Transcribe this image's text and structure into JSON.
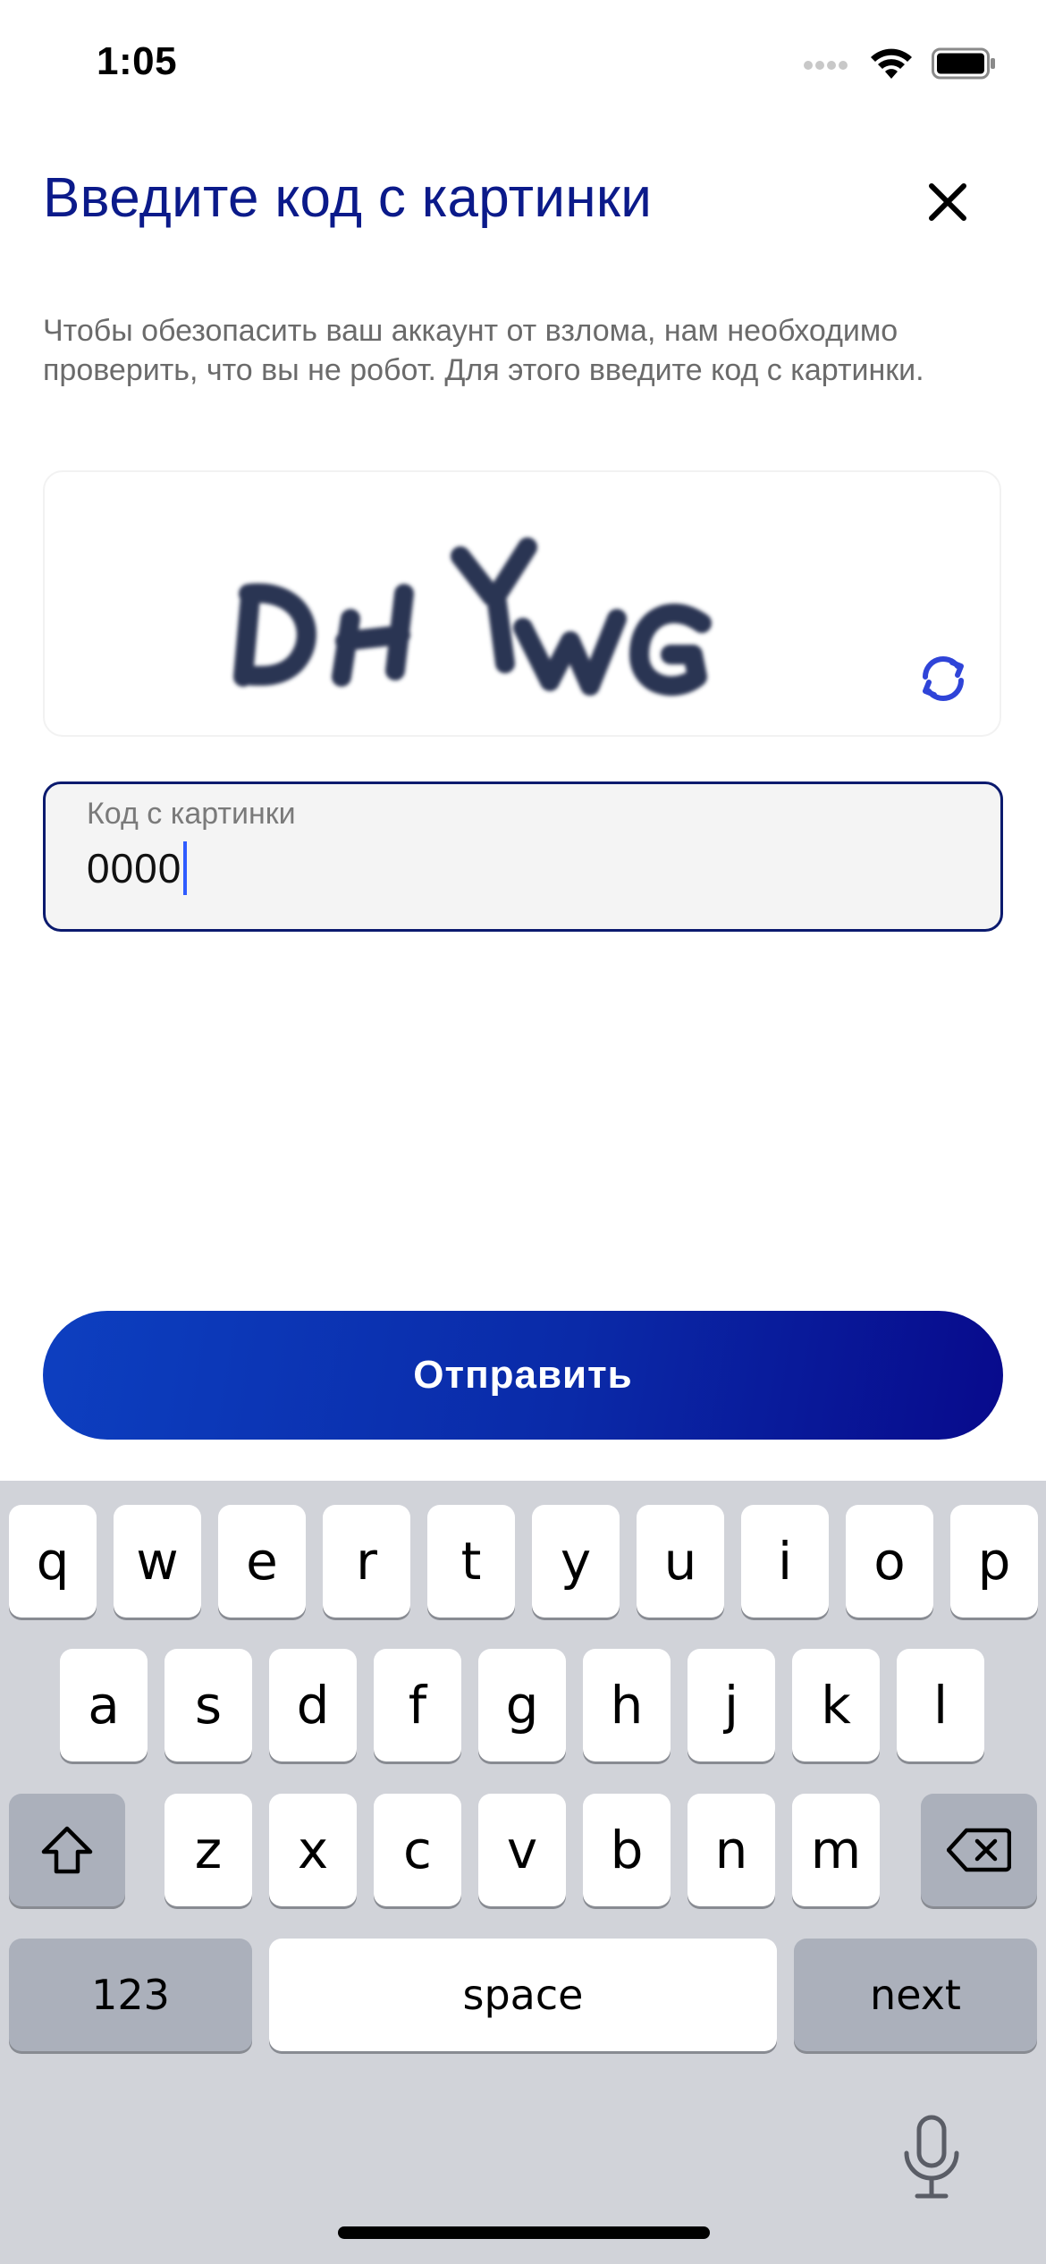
{
  "status_bar": {
    "time": "1:05"
  },
  "dialog": {
    "title": "Введите код с картинки",
    "description": "Чтобы обезопасить ваш аккаунт от взлома, нам необходимо проверить, что вы не робот. Для этого введите код с картинки.",
    "captcha_text": "DHYWG",
    "code_field": {
      "label": "Код с картинки",
      "value": "0000"
    },
    "submit_label": "Отправить"
  },
  "keyboard": {
    "row1": [
      "q",
      "w",
      "e",
      "r",
      "t",
      "y",
      "u",
      "i",
      "o",
      "p"
    ],
    "row2": [
      "a",
      "s",
      "d",
      "f",
      "g",
      "h",
      "j",
      "k",
      "l"
    ],
    "row3": [
      "z",
      "x",
      "c",
      "v",
      "b",
      "n",
      "m"
    ],
    "numbers_label": "123",
    "space_label": "space",
    "next_label": "next"
  },
  "colors": {
    "accent": "#0b1a8a",
    "caret": "#2e5bff",
    "keyboard_bg": "#d1d3d9"
  }
}
